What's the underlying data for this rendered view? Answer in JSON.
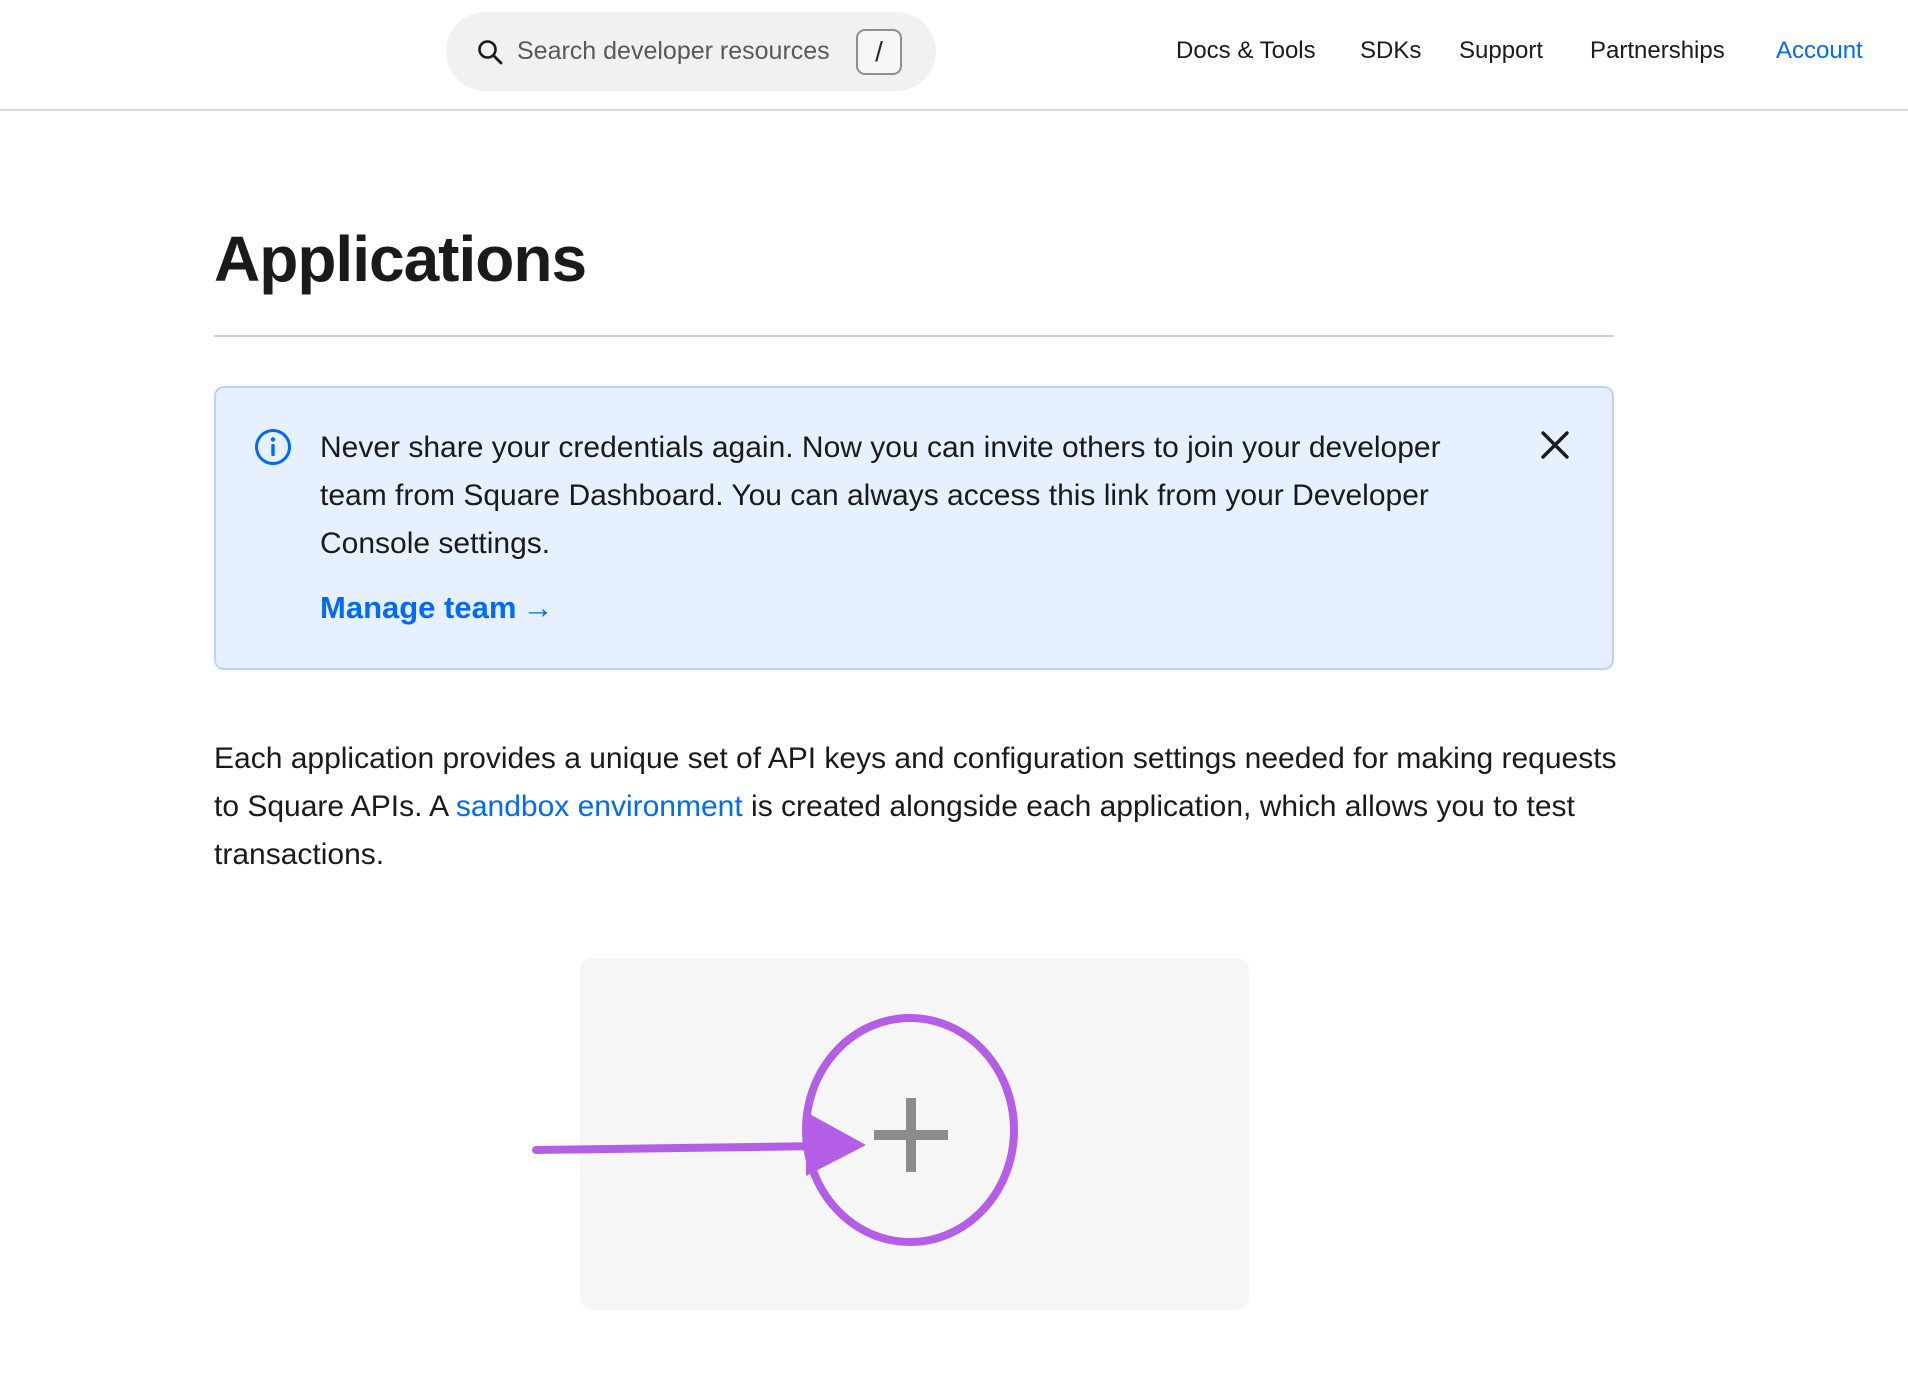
{
  "header": {
    "search": {
      "placeholder": "Search developer resources",
      "shortcut_key": "/"
    },
    "nav": [
      {
        "label": "Docs & Tools"
      },
      {
        "label": "SDKs"
      },
      {
        "label": "Support"
      },
      {
        "label": "Partnerships"
      },
      {
        "label": "Account",
        "active": true
      }
    ]
  },
  "main": {
    "title": "Applications",
    "banner": {
      "message": "Never share your credentials again. Now you can invite others to join your developer team from Square Dashboard. You can always access this link from your Developer Console settings.",
      "link_label": "Manage team",
      "link_arrow": "→"
    },
    "description": {
      "before_link": "Each application provides a unique set of API keys and configuration settings needed for making requests to Square APIs. A ",
      "link_label": "sandbox environment",
      "after_link": " is created alongside each application, which allows you to test transactions."
    }
  },
  "colors": {
    "accent": "#006aff",
    "banner_bg": "#e6f0ff",
    "banner_border": "#b8d4fb",
    "card_bg": "#f6f6f6",
    "plus": "#8c8c8c",
    "annotation": "#b45ee8"
  },
  "icons": {
    "search": "search-icon",
    "info": "info-icon",
    "close": "close-icon",
    "plus": "plus-icon"
  }
}
